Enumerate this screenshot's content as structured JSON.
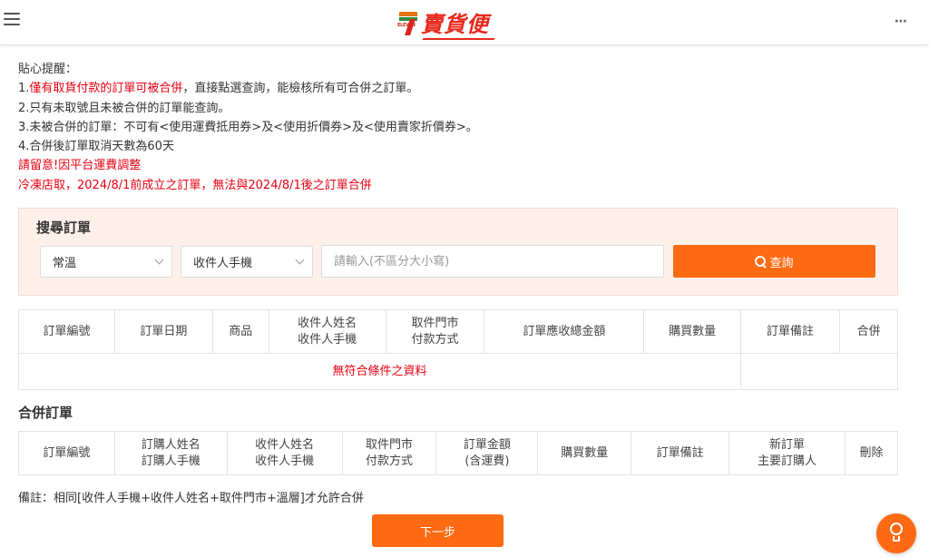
{
  "header": {
    "logo_text": "賣貨便",
    "logo_small": "ELEVEN",
    "more_icon": "⋯",
    "hamburger_icon": "hamburger-icon"
  },
  "notes": {
    "title": "貼心提醒：",
    "line1_prefix": "1.",
    "line1_red": "僅有取貨付款的訂單可被合併",
    "line1_rest": "，直接點選查詢，能檢核所有可合併之訂單。",
    "line2": "2.只有未取號且未被合併的訂單能查詢。",
    "line3": "3.未被合併的訂單：不可有<使用運費抵用券>及<使用折價券>及<使用賣家折價券>。",
    "line4": "4.合併後訂單取消天數為60天",
    "warning1": "請留意!因平台運費調整",
    "warning2": "冷凍店取，2024/8/1前成立之訂單，無法與2024/8/1後之訂單合併"
  },
  "search": {
    "title": "搜尋訂單",
    "temp_value": "常溫",
    "field_value": "收件人手機",
    "input_placeholder": "請輸入(不區分大小寫)",
    "button_label": "查詢"
  },
  "orders_table": {
    "headers": [
      "訂單編號",
      "訂單日期",
      "商品",
      "收件人姓名\n收件人手機",
      "取件門市\n付款方式",
      "訂單應收總金額",
      "購買數量",
      "訂單備註",
      "合併"
    ],
    "empty_text": "無符合條件之資料"
  },
  "merge": {
    "title": "合併訂單",
    "headers": [
      "訂單編號",
      "訂購人姓名\n訂購人手機",
      "收件人姓名\n收件人手機",
      "取件門市\n付款方式",
      "訂單金額\n(含運費)",
      "購買數量",
      "訂單備註",
      "新訂單\n主要訂購人",
      "刪除"
    ]
  },
  "remark": "備註：相同[收件人手機+收件人姓名+取件門市+溫層]才允許合併",
  "next_button": "下一步",
  "colors": {
    "accent": "#ff6a13",
    "warning_red": "#e60012",
    "panel_bg": "#fdf0ea"
  }
}
